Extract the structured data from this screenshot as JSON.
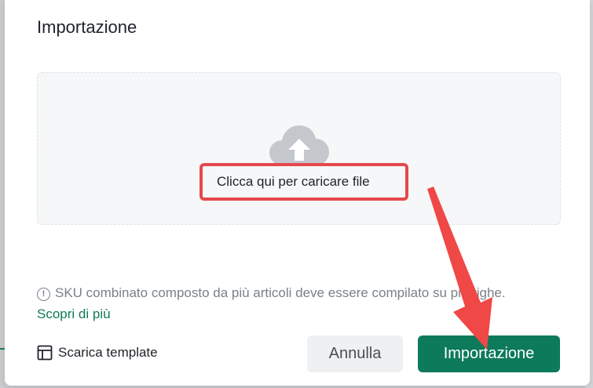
{
  "dialog": {
    "title": "Importazione",
    "dropzone": {
      "icon": "cloud-upload-icon",
      "upload_label": "Clicca qui per caricare file"
    },
    "notice": {
      "icon": "info-circle-icon",
      "text": "SKU combinato composto da più articoli deve essere compilato su più righe.",
      "link": "Scopri di più"
    },
    "footer": {
      "template_icon": "layout-template-icon",
      "template_label": "Scarica template",
      "cancel_label": "Annulla",
      "import_label": "Importazione"
    }
  },
  "colors": {
    "primary": "#0d7a5b",
    "highlight": "#e5484d"
  }
}
